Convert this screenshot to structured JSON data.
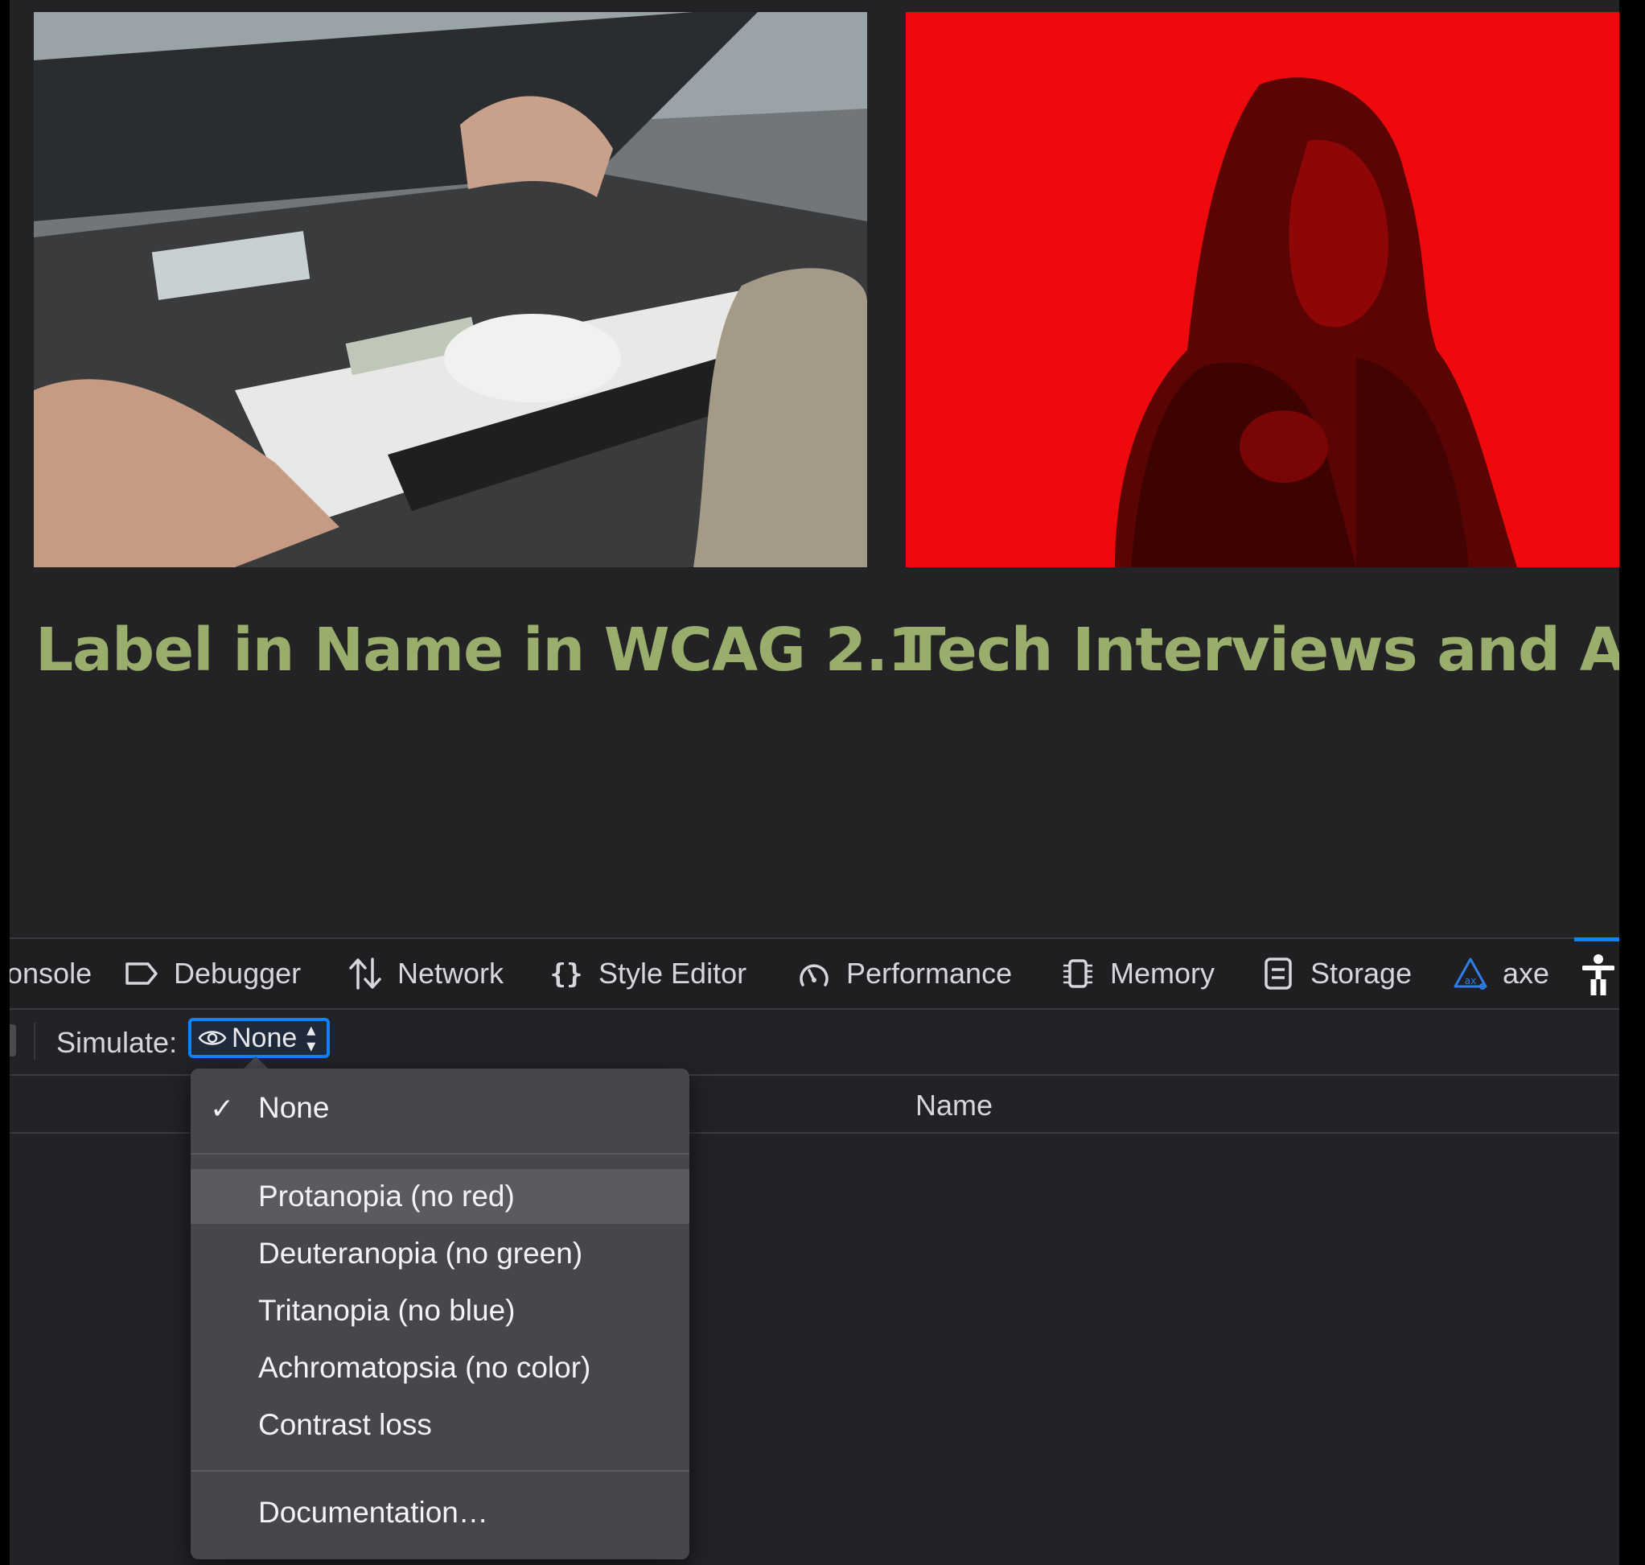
{
  "page": {
    "cards": [
      {
        "title": "Label in Name in WCAG 2.1",
        "image": "braille-display-photo"
      },
      {
        "title": "Tech Interviews and Anx",
        "image": "woman-red-background-photo"
      }
    ]
  },
  "devtools": {
    "tabs": [
      {
        "label": "onsole",
        "icon": "console-icon"
      },
      {
        "label": "Debugger",
        "icon": "debugger-icon"
      },
      {
        "label": "Network",
        "icon": "network-icon"
      },
      {
        "label": "Style Editor",
        "icon": "braces-icon"
      },
      {
        "label": "Performance",
        "icon": "gauge-icon"
      },
      {
        "label": "Memory",
        "icon": "chip-icon"
      },
      {
        "label": "Storage",
        "icon": "storage-icon"
      },
      {
        "label": "axe",
        "icon": "axe-icon"
      },
      {
        "label": "",
        "icon": "accessibility-icon",
        "active": true
      }
    ],
    "toolbar": {
      "simulate_label": "Simulate:",
      "simulate_value": "None"
    },
    "table": {
      "column_name": "Name"
    },
    "simulate_menu": {
      "selected": "None",
      "options": [
        "None",
        "Protanopia (no red)",
        "Deuteranopia (no green)",
        "Tritanopia (no blue)",
        "Achromatopsia (no color)",
        "Contrast loss",
        "Documentation…"
      ],
      "highlighted": "Protanopia (no red)"
    }
  },
  "colors": {
    "title_green": "#99ae6c",
    "accent_blue": "#0a84ff",
    "menu_bg": "#46464c",
    "page_bg": "#232325"
  }
}
